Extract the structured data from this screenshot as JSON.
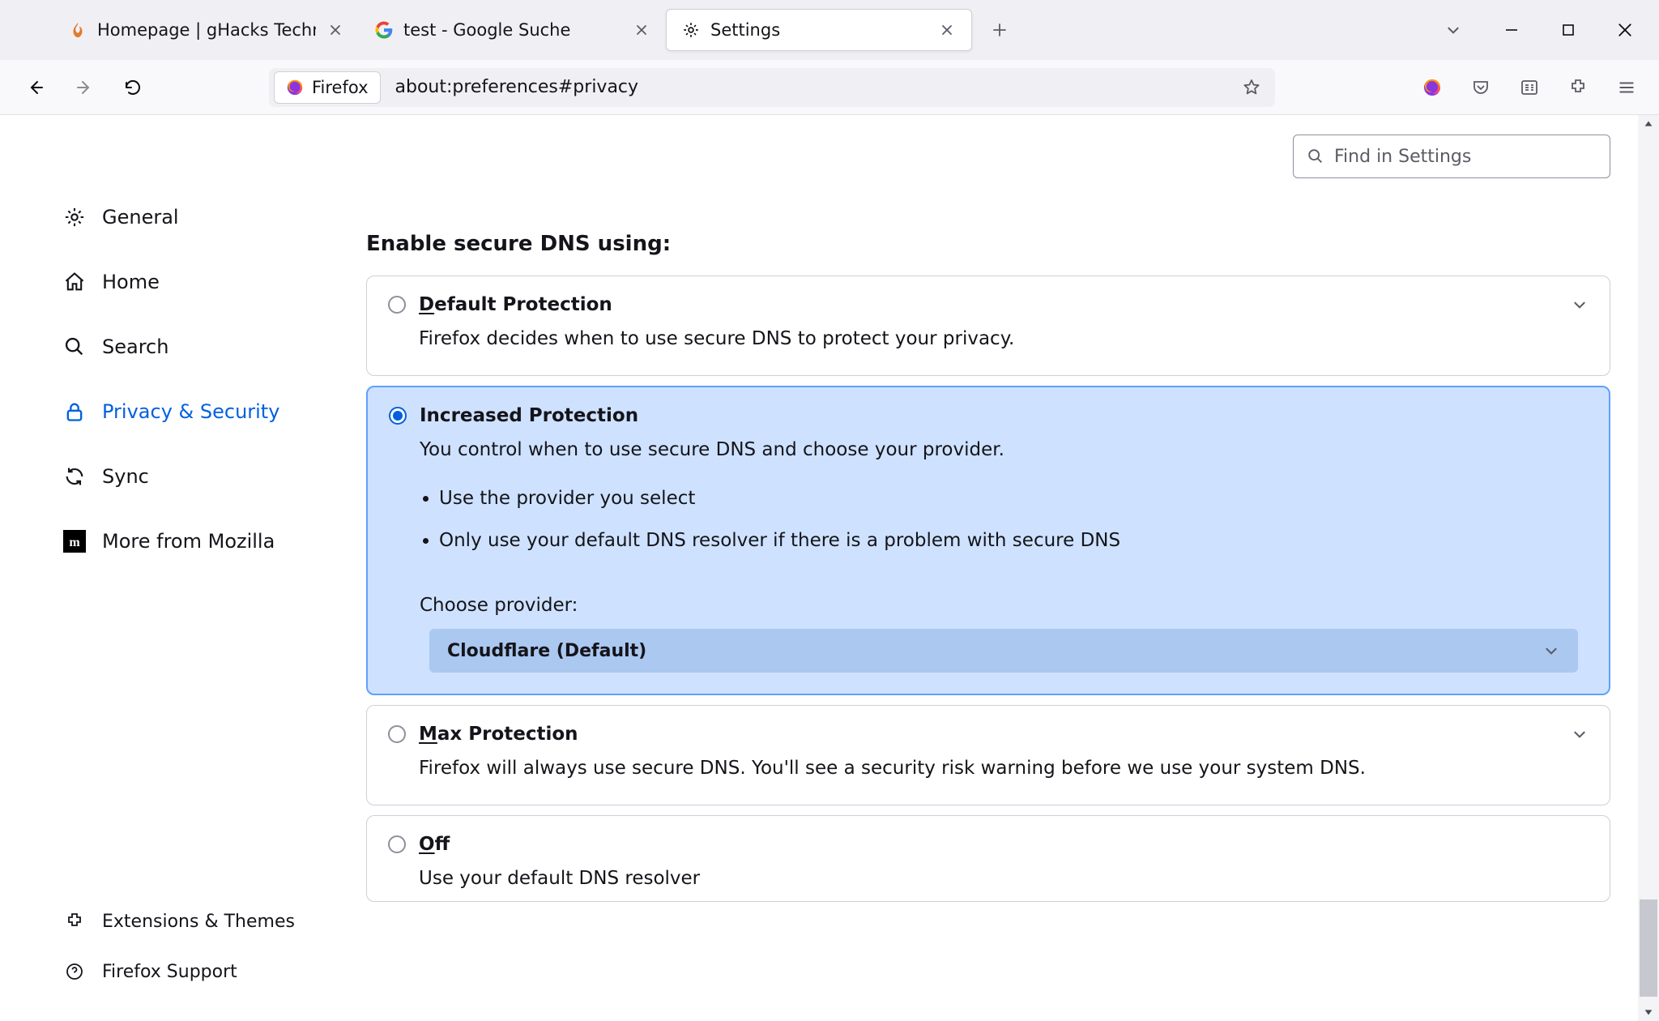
{
  "tabs": [
    {
      "title": "Homepage | gHacks Technology"
    },
    {
      "title": "test - Google Suche"
    },
    {
      "title": "Settings"
    }
  ],
  "urlbar": {
    "identity_label": "Firefox",
    "url": "about:preferences#privacy"
  },
  "search": {
    "placeholder": "Find in Settings"
  },
  "sidebar": {
    "general": "General",
    "home": "Home",
    "search": "Search",
    "privacy": "Privacy & Security",
    "sync": "Sync",
    "more": "More from Mozilla",
    "ext": "Extensions & Themes",
    "support": "Firefox Support"
  },
  "section_title": "Enable secure DNS using:",
  "opts": {
    "default": {
      "label_u": "D",
      "label_rest": "efault Protection",
      "desc": "Firefox decides when to use secure DNS to protect your privacy."
    },
    "increased": {
      "label": "Increased Protection",
      "desc": "You control when to use secure DNS and choose your provider.",
      "bul1": "Use the provider you select",
      "bul2": "Only use your default DNS resolver if there is a problem with secure DNS",
      "choose": "Choose provider:",
      "provider": "Cloudflare (Default)"
    },
    "max": {
      "label_u": "M",
      "label_rest": "ax Protection",
      "desc": "Firefox will always use secure DNS. You'll see a security risk warning before we use your system DNS."
    },
    "off": {
      "label_u": "O",
      "label_rest": "ff",
      "desc": "Use your default DNS resolver"
    }
  }
}
